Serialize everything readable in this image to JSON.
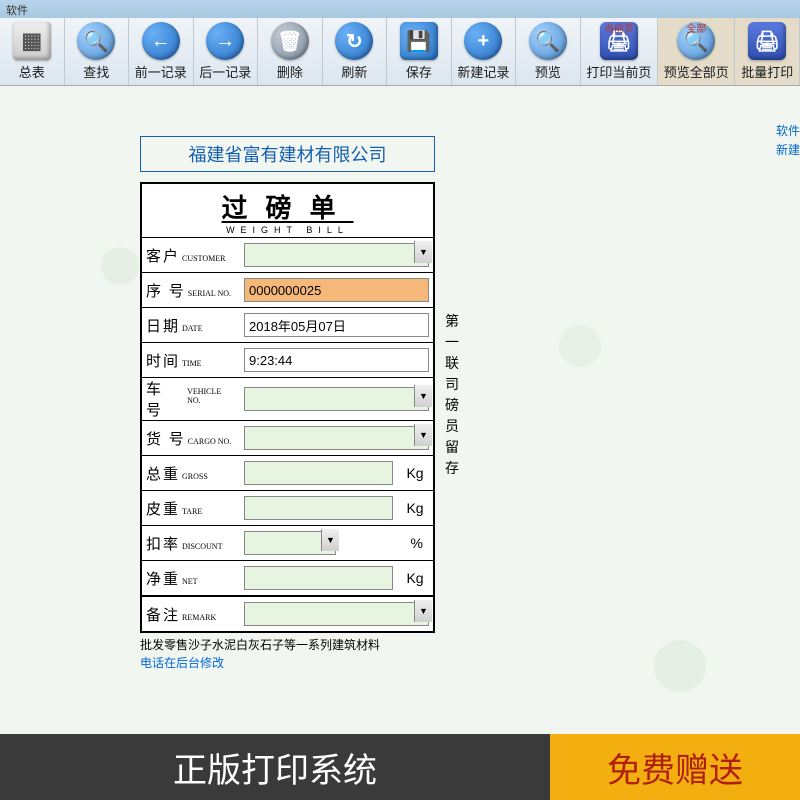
{
  "title_bar": "软件",
  "toolbar": [
    {
      "label": "总表",
      "icon": "table"
    },
    {
      "label": "查找",
      "icon": "lens",
      "glyph": "⌕"
    },
    {
      "label": "前一记录",
      "icon": "arrow",
      "glyph": "←"
    },
    {
      "label": "后一记录",
      "icon": "arrow",
      "glyph": "→"
    },
    {
      "label": "删除",
      "icon": "trash",
      "glyph": "🗑"
    },
    {
      "label": "刷新",
      "icon": "refresh",
      "glyph": "↻"
    },
    {
      "label": "保存",
      "icon": "save",
      "glyph": "💾"
    },
    {
      "label": "新建记录",
      "icon": "plus",
      "glyph": "+"
    },
    {
      "label": "预览",
      "icon": "lens",
      "glyph": "⌕"
    },
    {
      "label": "打印当前页",
      "icon": "print",
      "glyph": "🖨",
      "badge": "当前页"
    },
    {
      "label": "预览全部页",
      "icon": "lens",
      "glyph": "⌕",
      "badge": "全部"
    },
    {
      "label": "批量打印",
      "icon": "print",
      "glyph": "🖨"
    }
  ],
  "side_links": [
    "软件",
    "新建"
  ],
  "company": "福建省富有建材有限公司",
  "bill": {
    "title_cn": "过磅单",
    "title_en": "WEIGHT   BILL",
    "copy_label": "第一联　司磅员留存",
    "rows": {
      "customer": {
        "cn": "客户",
        "en": "CUSTOMER",
        "type": "select",
        "value": ""
      },
      "serial": {
        "cn": "序 号",
        "en": "SERIAL NO.",
        "type": "text",
        "value": "0000000025",
        "highlight": true
      },
      "date": {
        "cn": "日期",
        "en": "DATE",
        "type": "text",
        "value": "2018年05月07日"
      },
      "time": {
        "cn": "时间",
        "en": "TIME",
        "type": "text",
        "value": "9:23:44"
      },
      "vehicle": {
        "cn": "车 号",
        "en": "VEHICLE NO.",
        "type": "select",
        "value": ""
      },
      "cargo": {
        "cn": "货 号",
        "en": "CARGO NO.",
        "type": "select",
        "value": ""
      },
      "gross": {
        "cn": "总重",
        "en": "GROSS",
        "type": "text",
        "value": "",
        "unit": "Kg"
      },
      "tare": {
        "cn": "皮重",
        "en": "TARE",
        "type": "text",
        "value": "",
        "unit": "Kg"
      },
      "discount": {
        "cn": "扣率",
        "en": "DISCOUNT",
        "type": "select",
        "value": "",
        "unit": "%"
      },
      "net": {
        "cn": "净重",
        "en": "NET",
        "type": "text",
        "value": "",
        "unit": "Kg"
      },
      "remark": {
        "cn": "备注",
        "en": "REMARK",
        "type": "select",
        "value": ""
      }
    },
    "footer1": "批发零售沙子水泥白灰石子等一系列建筑材料",
    "footer2": "电话在后台修改"
  },
  "banner": {
    "left": "正版打印系统",
    "right": "免费赠送"
  }
}
